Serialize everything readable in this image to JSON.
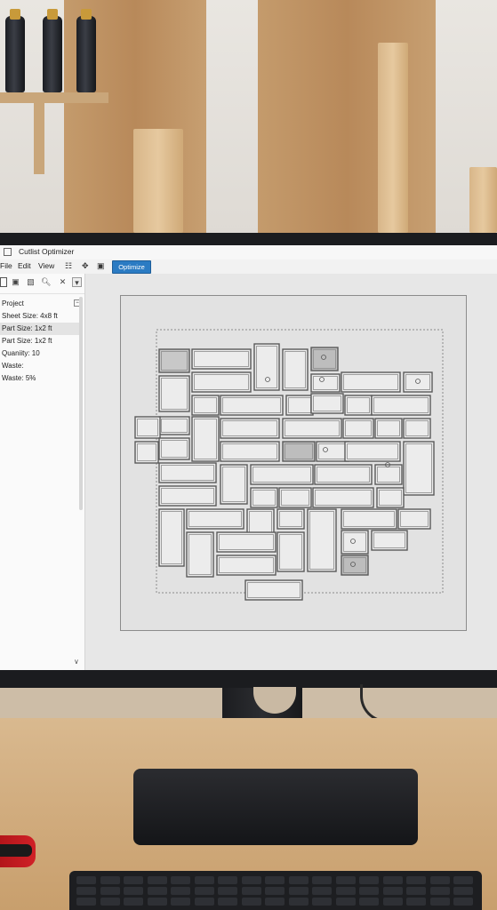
{
  "window": {
    "title": "Cutlist Optimizer"
  },
  "menu": {
    "file": "File",
    "edit": "Edit",
    "view": "View",
    "optimize_label": "Optimize",
    "toolbar_icons": [
      "layout-icon",
      "move-icon",
      "lock-icon"
    ]
  },
  "sidebar": {
    "tool_icons": [
      "select-tool-icon",
      "camera-icon",
      "import-icon",
      "search-icon",
      "close-icon",
      "dropdown-icon"
    ],
    "items": [
      {
        "label": "Project"
      },
      {
        "label": "Sheet Size: 4x8 ft"
      },
      {
        "label": "Part Size: 1x2 ft"
      },
      {
        "label": "Part Size: 1x2 ft"
      },
      {
        "label": "Quaniity: 10"
      },
      {
        "label": "Waste:"
      },
      {
        "label": "Waste: 5%"
      }
    ],
    "selected_index": 2
  },
  "canvas": {
    "description_items": "sheet layout with nested part rectangles"
  },
  "colors": {
    "accent": "#2b7bc3",
    "canvas_bg": "#e7e7e7",
    "part_stroke": "#5a5a5a"
  }
}
